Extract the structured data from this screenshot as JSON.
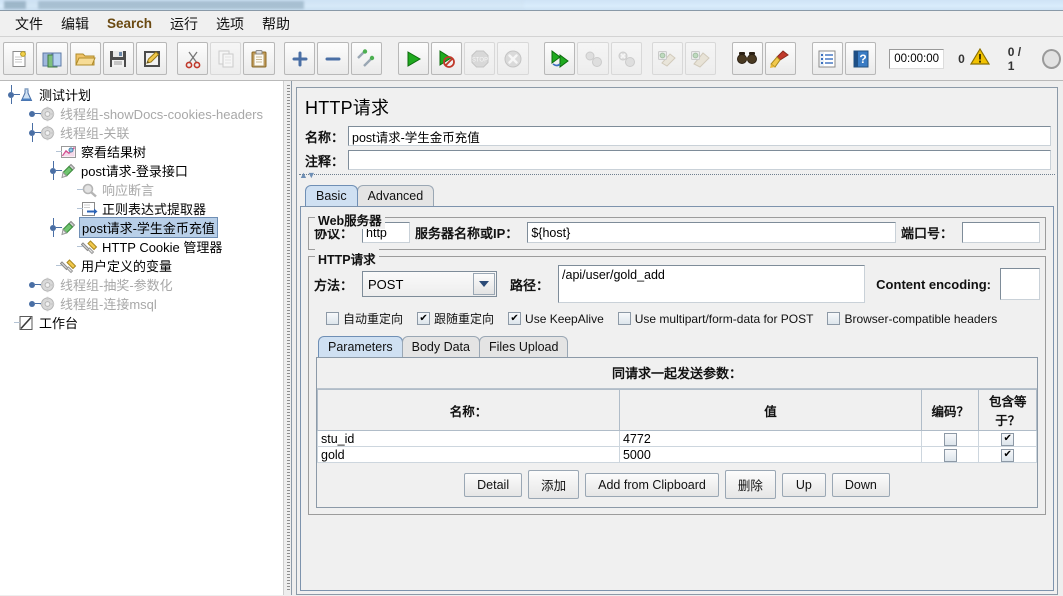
{
  "window": {
    "title_blurred": true
  },
  "menubar": {
    "items": [
      {
        "label": "文件",
        "latin": false
      },
      {
        "label": "编辑",
        "latin": false
      },
      {
        "label": "Search",
        "latin": true
      },
      {
        "label": "运行",
        "latin": false
      },
      {
        "label": "选项",
        "latin": false
      },
      {
        "label": "帮助",
        "latin": false
      }
    ]
  },
  "toolbar": {
    "buttons": [
      {
        "name": "new-icon",
        "enabled": true
      },
      {
        "name": "templates-icon",
        "enabled": true
      },
      {
        "name": "open-icon",
        "enabled": true
      },
      {
        "name": "save-icon",
        "enabled": true
      },
      {
        "name": "save-as-icon",
        "enabled": true
      },
      {
        "name": "cut-icon",
        "enabled": true
      },
      {
        "name": "copy-icon",
        "enabled": false
      },
      {
        "name": "paste-icon",
        "enabled": true
      },
      {
        "name": "expand-all-icon",
        "enabled": true
      },
      {
        "name": "collapse-all-icon",
        "enabled": true
      },
      {
        "name": "toggle-icon",
        "enabled": true
      },
      {
        "name": "start-icon",
        "enabled": true
      },
      {
        "name": "start-no-timers-icon",
        "enabled": true
      },
      {
        "name": "stop-icon",
        "enabled": false
      },
      {
        "name": "shutdown-icon",
        "enabled": false
      },
      {
        "name": "start-remote-all-icon",
        "enabled": true
      },
      {
        "name": "stop-remote-all-icon",
        "enabled": false
      },
      {
        "name": "shutdown-remote-all-icon",
        "enabled": false
      },
      {
        "name": "clear-icon",
        "enabled": true
      },
      {
        "name": "clear-all-icon",
        "enabled": true
      },
      {
        "name": "search-icon",
        "enabled": true
      },
      {
        "name": "reset-search-icon",
        "enabled": true
      },
      {
        "name": "function-helper-icon",
        "enabled": true
      },
      {
        "name": "help-icon",
        "enabled": true
      }
    ],
    "elapsed_time": "00:00:00",
    "warning_count": "0",
    "thread_count": "0 / 1"
  },
  "tree": {
    "nodes": [
      {
        "depth": 0,
        "label": "测试计划",
        "icon": "test-plan-icon",
        "muted": false,
        "selected": false,
        "handle": "expanded"
      },
      {
        "depth": 1,
        "label": "线程组-showDocs-cookies-headers",
        "icon": "thread-group-icon",
        "muted": true,
        "selected": false,
        "handle": "collapsed"
      },
      {
        "depth": 1,
        "label": "线程组-关联",
        "icon": "thread-group-icon",
        "muted": true,
        "selected": false,
        "handle": "expanded"
      },
      {
        "depth": 2,
        "label": "察看结果树",
        "icon": "view-results-tree-icon",
        "muted": false,
        "selected": false,
        "handle": "none"
      },
      {
        "depth": 2,
        "label": "post请求-登录接口",
        "icon": "http-request-icon",
        "muted": false,
        "selected": false,
        "handle": "expanded"
      },
      {
        "depth": 3,
        "label": "响应断言",
        "icon": "assertion-icon",
        "muted": true,
        "selected": false,
        "handle": "none"
      },
      {
        "depth": 3,
        "label": "正则表达式提取器",
        "icon": "regex-extractor-icon",
        "muted": false,
        "selected": false,
        "handle": "none"
      },
      {
        "depth": 2,
        "label": "post请求-学生金币充值",
        "icon": "http-request-icon",
        "muted": false,
        "selected": true,
        "handle": "expanded"
      },
      {
        "depth": 3,
        "label": "HTTP Cookie 管理器",
        "icon": "cookie-manager-icon",
        "muted": false,
        "selected": false,
        "handle": "none"
      },
      {
        "depth": 2,
        "label": "用户定义的变量",
        "icon": "user-variables-icon",
        "muted": false,
        "selected": false,
        "handle": "none"
      },
      {
        "depth": 1,
        "label": "线程组-抽奖-参数化",
        "icon": "thread-group-icon",
        "muted": true,
        "selected": false,
        "handle": "collapsed"
      },
      {
        "depth": 1,
        "label": "线程组-连接msql",
        "icon": "thread-group-icon",
        "muted": true,
        "selected": false,
        "handle": "collapsed"
      },
      {
        "depth": 0,
        "label": "工作台",
        "icon": "workbench-icon",
        "muted": false,
        "selected": false,
        "handle": "none"
      }
    ]
  },
  "main": {
    "page_title": "HTTP请求",
    "name_label": "名称：",
    "name_value": "post请求-学生金币充值",
    "comment_label": "注释：",
    "comment_value": "",
    "tabs": [
      {
        "label": "Basic",
        "active": true
      },
      {
        "label": "Advanced",
        "active": false
      }
    ],
    "web_server": {
      "legend": "Web服务器",
      "protocol_label": "协议：",
      "protocol_value": "http",
      "server_label": "服务器名称或IP：",
      "server_value": "${host}",
      "port_label": "端口号：",
      "port_value": ""
    },
    "http_request": {
      "legend": "HTTP请求",
      "method_label": "方法：",
      "method_value": "POST",
      "path_label": "路径：",
      "path_value": "/api/user/gold_add",
      "content_encoding_label": "Content encoding:",
      "content_encoding_value": ""
    },
    "options": [
      {
        "label": "自动重定向",
        "checked": false
      },
      {
        "label": "跟随重定向",
        "checked": true
      },
      {
        "label": "Use KeepAlive",
        "checked": true
      },
      {
        "label": "Use multipart/form-data for POST",
        "checked": false
      },
      {
        "label": "Browser-compatible headers",
        "checked": false
      }
    ],
    "param_tabs": [
      {
        "label": "Parameters",
        "active": true
      },
      {
        "label": "Body Data",
        "active": false
      },
      {
        "label": "Files Upload",
        "active": false
      }
    ],
    "params_table": {
      "caption": "同请求一起发送参数：",
      "columns": [
        "名称：",
        "值",
        "编码？",
        "包含等于？"
      ],
      "rows": [
        {
          "name": "stu_id",
          "value": "4772",
          "encode": false,
          "include_equals": true
        },
        {
          "name": "gold",
          "value": "5000",
          "encode": false,
          "include_equals": true
        }
      ]
    },
    "buttons": [
      {
        "label": "Detail"
      },
      {
        "label": "添加"
      },
      {
        "label": "Add from Clipboard"
      },
      {
        "label": "删除"
      },
      {
        "label": "Up"
      },
      {
        "label": "Down"
      }
    ]
  },
  "colors": {
    "selection": "#b8cfe8",
    "tab_active": "#cfe0f2",
    "panel": "#f0f0f0",
    "muted_text": "#a8a8a8",
    "menu_accent": "#6b4a12"
  }
}
